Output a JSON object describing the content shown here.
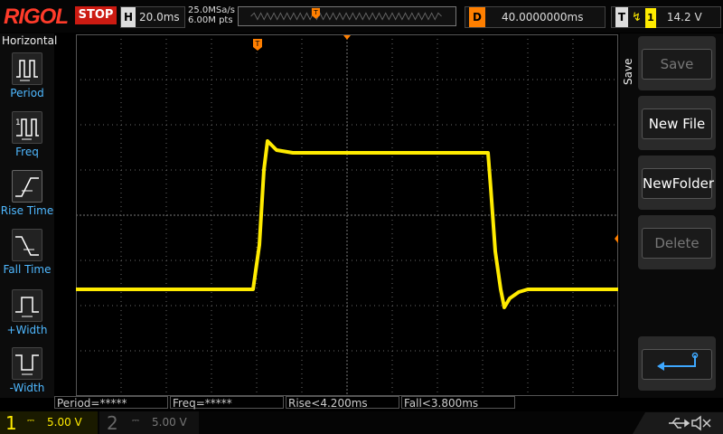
{
  "header": {
    "brand": "RIGOL",
    "run_state": "STOP",
    "timebase_letter": "H",
    "timebase": "20.0ms",
    "sample_rate": "25.0MSa/s",
    "memory_depth": "6.00M pts",
    "delay_letter": "D",
    "delay": "40.0000000ms",
    "trigger_letter": "T",
    "trigger_channel": "1",
    "trigger_level": "14.2 V"
  },
  "left_menu": {
    "title": "Horizontal",
    "items": [
      {
        "label": "Period",
        "icon": "period-icon"
      },
      {
        "label": "Freq",
        "icon": "frequency-icon"
      },
      {
        "label": "Rise Time",
        "icon": "rise-time-icon"
      },
      {
        "label": "Fall Time",
        "icon": "fall-time-icon"
      },
      {
        "label": "+Width",
        "icon": "positive-width-icon"
      },
      {
        "label": "-Width",
        "icon": "negative-width-icon"
      }
    ]
  },
  "right_menu": {
    "title": "Save",
    "buttons": [
      {
        "label": "Save",
        "state": "disabled"
      },
      {
        "label": "New File",
        "state": "enabled"
      },
      {
        "label": "NewFolder",
        "state": "enabled"
      },
      {
        "label": "Delete",
        "state": "disabled"
      },
      {
        "label": "",
        "icon": "return-arrow-icon"
      }
    ]
  },
  "measurements": {
    "period": "Period=*****",
    "freq": "Freq=*****",
    "rise": "Rise<4.200ms",
    "fall": "Fall<3.800ms"
  },
  "channels": {
    "ch1": {
      "number": "1",
      "scale": "5.00 V",
      "color": "#ffeb00",
      "marker": "1"
    },
    "ch2": {
      "number": "2",
      "scale": "5.00 V"
    }
  },
  "trigger_marker": "T",
  "status": {
    "usb": "USB",
    "speaker": "muted"
  },
  "colors": {
    "trace": "#ffeb00",
    "trigger": "#ff7f00",
    "stop": "#cc1b12",
    "menu_text": "#4fb8ff"
  }
}
